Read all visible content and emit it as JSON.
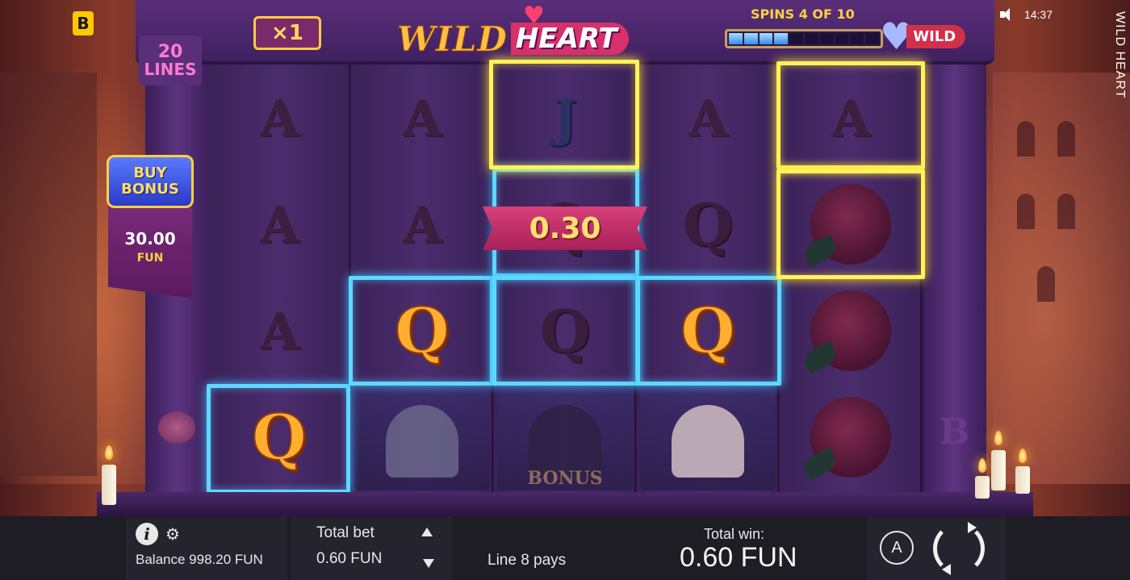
{
  "brand": {
    "badge": "B"
  },
  "status": {
    "time": "14:37",
    "sound_icon": "speaker-icon"
  },
  "game_title_vertical": "WILD HEART",
  "logo": {
    "word1": "WILD",
    "word2": "HEART"
  },
  "multiplier": "×1",
  "lines": {
    "count": "20",
    "label": "LINES"
  },
  "free_spins": {
    "label": "SPINS 4 OF 10",
    "current": 4,
    "total": 10,
    "wild_tag": "WILD"
  },
  "buy_bonus": {
    "line1": "BUY",
    "line2": "BONUS",
    "price": "30.00",
    "currency": "FUN"
  },
  "reels": [
    [
      "A",
      "A",
      "A",
      "Q"
    ],
    [
      "A",
      "A",
      "Q",
      "raccoon"
    ],
    [
      "J",
      "Q",
      "Q",
      "horse-bonus"
    ],
    [
      "A",
      "Q",
      "Q",
      "lady"
    ],
    [
      "A",
      "rose",
      "rose",
      "rose"
    ]
  ],
  "bonus_symbol_label": "BONUS",
  "win_badge": "0.30",
  "pillar_letter": "B",
  "bottom_bar": {
    "balance": "Balance 998.20 FUN",
    "total_bet_label": "Total bet",
    "total_bet_value": "0.60 FUN",
    "line_pays": "Line 8 pays",
    "total_win_label": "Total win:",
    "total_win_value": "0.60 FUN",
    "autoplay_label": "A"
  }
}
